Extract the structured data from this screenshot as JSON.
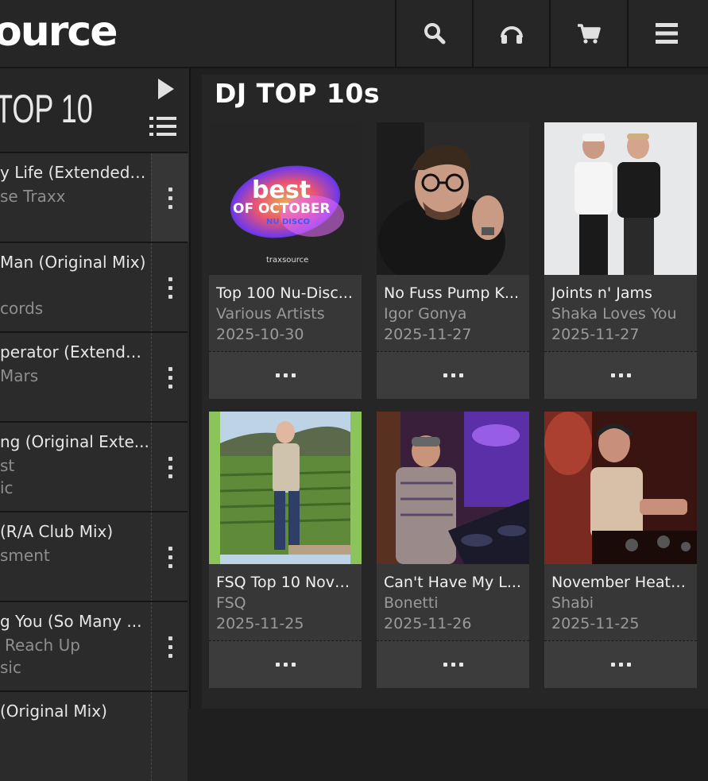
{
  "header": {
    "logo_text": "ource",
    "icons": [
      "search-icon",
      "headphones-icon",
      "cart-icon",
      "menu-icon"
    ]
  },
  "left_panel": {
    "title": "TOP 10",
    "tracks": [
      {
        "title": "y Life (Extended ...",
        "line2": "se Traxx",
        "line3": ""
      },
      {
        "title": "Man (Original Mix)",
        "line2": "cords",
        "line3": ""
      },
      {
        "title": "perator (Extende...",
        "line2": "Mars",
        "line3": ""
      },
      {
        "title": "ng (Original Exte...",
        "line2": "st",
        "line3": "ic"
      },
      {
        "title": "(R/A Club Mix)",
        "line2": "sment",
        "line3": ""
      },
      {
        "title": "g You (So Many ...",
        "line2": "Reach Up",
        "line3": "sic"
      },
      {
        "title": "(Original Mix)",
        "line2": "",
        "line3": ""
      }
    ]
  },
  "main": {
    "title": "DJ TOP 10s",
    "cards": [
      {
        "title": "Top 100 Nu-Disc...",
        "artist": "Various Artists",
        "date": "2025-10-30",
        "art_text": {
          "l1": "best",
          "l2": "OF OCTOBER",
          "l3": "NU DISCO",
          "brand": "traxsource"
        }
      },
      {
        "title": "No Fuss Pump K...",
        "artist": "Igor Gonya",
        "date": "2025-11-27"
      },
      {
        "title": "Joints n' Jams",
        "artist": "Shaka Loves You",
        "date": "2025-11-27"
      },
      {
        "title": "FSQ Top 10 Nove...",
        "artist": "FSQ",
        "date": "2025-11-25"
      },
      {
        "title": "Can't Have My L...",
        "artist": "Bonetti",
        "date": "2025-11-26"
      },
      {
        "title": "November Heaters",
        "artist": "Shabi",
        "date": "2025-11-25"
      }
    ]
  },
  "colors": {
    "background": "#1f1f1f",
    "panel": "#262626",
    "card": "#373737",
    "muted_text": "#9a9a9a"
  }
}
